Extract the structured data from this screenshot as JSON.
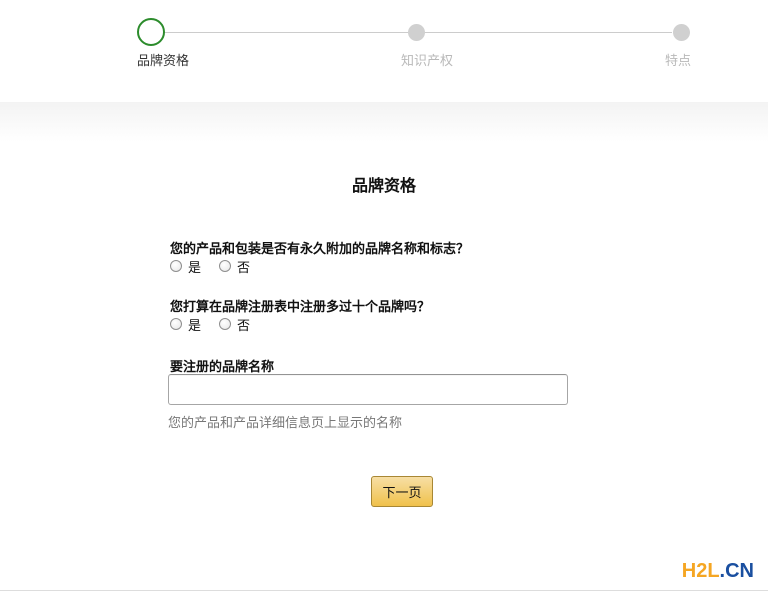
{
  "stepper": {
    "steps": [
      {
        "label": "品牌资格",
        "state": "active"
      },
      {
        "label": "知识产权",
        "state": "inactive"
      },
      {
        "label": "特点",
        "state": "inactive"
      }
    ],
    "active_color": "#2c8c2c",
    "inactive_color": "#d0d0d0"
  },
  "main": {
    "title": "品牌资格",
    "question1": {
      "text": "您的产品和包装是否有永久附加的品牌名称和标志？",
      "options": [
        "是",
        "否"
      ]
    },
    "question2": {
      "text": "您打算在品牌注册表中注册多过十个品牌吗？",
      "options": [
        "是",
        "否"
      ]
    },
    "brand_name_field": {
      "label": "要注册的品牌名称",
      "value": "",
      "placeholder": "",
      "hint": "您的产品和产品详细信息页上显示的名称"
    },
    "next_button_label": "下一页",
    "button_color": "#f0c14b"
  },
  "watermark": {
    "part1": "H2L",
    "part2": ".CN"
  }
}
